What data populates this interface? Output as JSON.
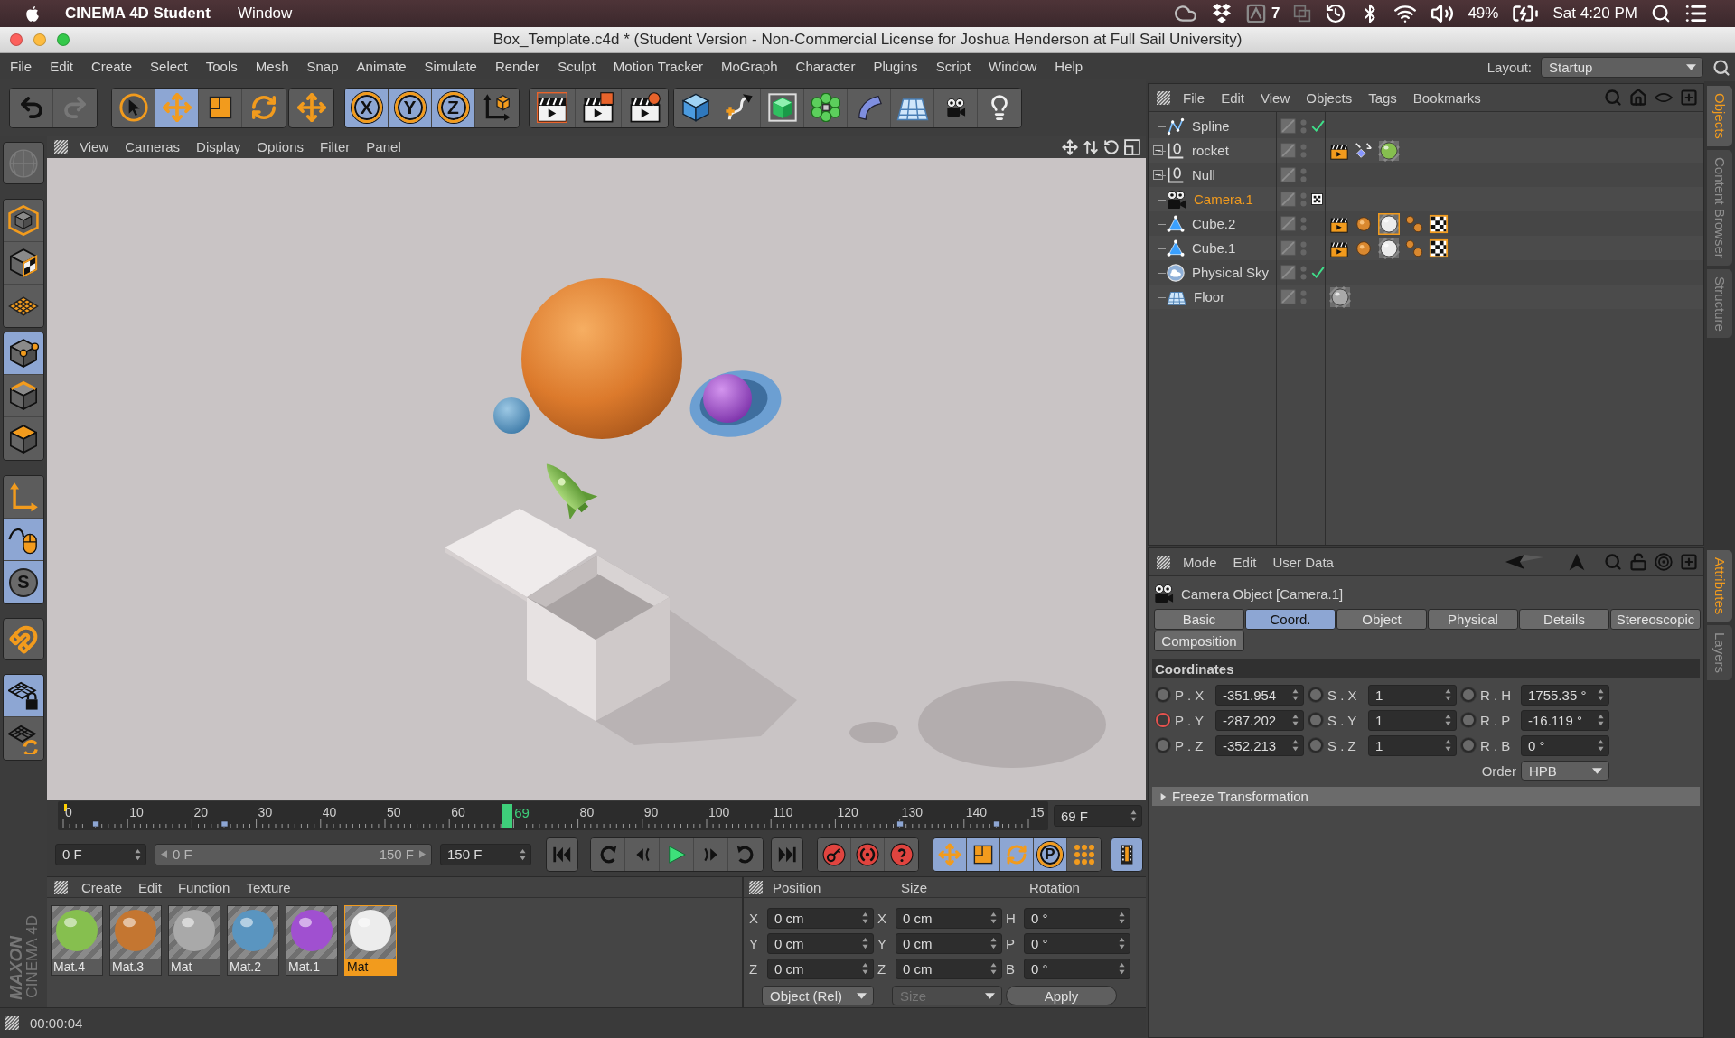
{
  "system_bar": {
    "app_name": "CINEMA 4D Student",
    "menus": [
      "Window"
    ],
    "badge": "7",
    "battery": "49%",
    "clock": "Sat 4:20 PM"
  },
  "window": {
    "title": "Box_Template.c4d * (Student Version - Non-Commercial License for Joshua Henderson at Full Sail University)"
  },
  "menu": [
    "File",
    "Edit",
    "Create",
    "Select",
    "Tools",
    "Mesh",
    "Snap",
    "Animate",
    "Simulate",
    "Render",
    "Sculpt",
    "Motion Tracker",
    "MoGraph",
    "Character",
    "Plugins",
    "Script",
    "Window",
    "Help"
  ],
  "layout": {
    "label": "Layout:",
    "value": "Startup"
  },
  "toolbar": {
    "history": [
      {
        "disabled": false
      },
      {
        "disabled": true
      }
    ],
    "tools": [
      {
        "selected": false
      },
      {
        "selected": true
      },
      {
        "selected": false
      },
      {
        "selected": false
      }
    ],
    "recent": {
      "selected": false
    },
    "axes": [
      {
        "label": "X",
        "on": true
      },
      {
        "label": "Y",
        "on": true
      },
      {
        "label": "Z",
        "on": true
      }
    ]
  },
  "mode_bar": [
    {
      "on": false,
      "disabled": true
    },
    {
      "on": false,
      "disabled": false
    },
    {
      "on": false,
      "disabled": false
    },
    {
      "on": false,
      "disabled": false
    },
    {
      "on": true,
      "disabled": false
    },
    {
      "on": false,
      "disabled": false
    },
    {
      "on": false,
      "disabled": false
    },
    {
      "on": false,
      "disabled": false
    },
    {
      "on": true,
      "disabled": false
    },
    {
      "on": true,
      "disabled": false,
      "label": "S"
    },
    {
      "on": false,
      "disabled": false
    },
    {
      "on": true,
      "disabled": false
    },
    {
      "on": false,
      "disabled": false
    }
  ],
  "brand": {
    "company": "MAXON",
    "product": "CINEMA 4D"
  },
  "viewport": {
    "menus": [
      "View",
      "Cameras",
      "Display",
      "Options",
      "Filter",
      "Panel"
    ]
  },
  "timeline": {
    "ticks": [
      "0",
      "10",
      "20",
      "30",
      "40",
      "50",
      "60"
    ],
    "ticks_after_playhead": [
      "80",
      "90",
      "100",
      "110",
      "120",
      "130",
      "140",
      "15"
    ],
    "playhead": {
      "label": "69",
      "level": 0.46
    },
    "frame_field": "69 F"
  },
  "range": {
    "start": "0 F",
    "slider_start": "0 F",
    "slider_end": "150 F",
    "end": "150 F"
  },
  "key_toggles": [
    {
      "on": true
    },
    {
      "on": true
    },
    {
      "on": true
    },
    {
      "on": true,
      "label": "P"
    },
    {
      "on": false
    }
  ],
  "timeline_button": {
    "on": true
  },
  "materials": {
    "menus": [
      "Create",
      "Edit",
      "Function",
      "Texture"
    ],
    "items": [
      {
        "name": "Mat.4",
        "color": "#86bf4f",
        "selected": false
      },
      {
        "name": "Mat.3",
        "color": "#c47631",
        "selected": false
      },
      {
        "name": "Mat",
        "color": "#a9a9a9",
        "selected": false
      },
      {
        "name": "Mat.2",
        "color": "#5a95c0",
        "selected": false
      },
      {
        "name": "Mat.1",
        "color": "#a050d0",
        "selected": false
      },
      {
        "name": "Mat",
        "color": "#ececec",
        "selected": true
      }
    ]
  },
  "coordinates": {
    "headers": [
      "Position",
      "Size",
      "Rotation"
    ],
    "rows": [
      {
        "position_axis": "X",
        "position": "0 cm",
        "size_axis": "X",
        "size": "0 cm",
        "rotation_axis": "H",
        "rotation": "0 °"
      },
      {
        "position_axis": "Y",
        "position": "0 cm",
        "size_axis": "Y",
        "size": "0 cm",
        "rotation_axis": "P",
        "rotation": "0 °"
      },
      {
        "position_axis": "Z",
        "position": "0 cm",
        "size_axis": "Z",
        "size": "0 cm",
        "rotation_axis": "B",
        "rotation": "0 °"
      }
    ],
    "mode": "Object (Rel)",
    "size_mode": {
      "label": "Size",
      "disabled": true
    },
    "apply": "Apply"
  },
  "status_bar": {
    "time": "00:00:04"
  },
  "objects": {
    "menus": [
      "File",
      "Edit",
      "View",
      "Objects",
      "Tags",
      "Bookmarks"
    ],
    "items": [
      {
        "name": "Spline",
        "kind": "spline",
        "selected": false,
        "collapsed": false,
        "enabled": true,
        "active_view": false
      },
      {
        "name": "rocket",
        "kind": "null",
        "selected": false,
        "collapsed": true,
        "enabled": false,
        "active_view": false,
        "tags": [
          {
            "kind": "render",
            "selected": false
          },
          {
            "kind": "align",
            "selected": false
          },
          {
            "kind": "material",
            "color": "#86bf4f",
            "selected": false
          }
        ]
      },
      {
        "name": "Null",
        "kind": "null",
        "selected": false,
        "collapsed": true,
        "enabled": false,
        "active_view": false
      },
      {
        "name": "Camera.1",
        "kind": "camera",
        "selected": true,
        "collapsed": false,
        "enabled": false,
        "active_view": true
      },
      {
        "name": "Cube.2",
        "kind": "primitive",
        "selected": false,
        "collapsed": false,
        "enabled": false,
        "active_view": false,
        "tags": [
          {
            "kind": "render",
            "selected": false
          },
          {
            "kind": "sphere",
            "selected": false
          },
          {
            "kind": "material",
            "color": "#ececec",
            "selected": true
          },
          {
            "kind": "dots",
            "selected": false
          },
          {
            "kind": "checker",
            "selected": false
          }
        ]
      },
      {
        "name": "Cube.1",
        "kind": "primitive",
        "selected": false,
        "collapsed": false,
        "enabled": false,
        "active_view": false,
        "tags": [
          {
            "kind": "render",
            "selected": false
          },
          {
            "kind": "sphere",
            "selected": false
          },
          {
            "kind": "material",
            "color": "#ececec",
            "selected": false
          },
          {
            "kind": "dots",
            "selected": false
          },
          {
            "kind": "checker",
            "selected": false
          }
        ]
      },
      {
        "name": "Physical Sky",
        "kind": "sky",
        "selected": false,
        "collapsed": false,
        "enabled": true,
        "active_view": false
      },
      {
        "name": "Floor",
        "kind": "floor",
        "selected": false,
        "collapsed": false,
        "enabled": false,
        "active_view": false,
        "tags": [
          {
            "kind": "material",
            "color": "#a9a9a9",
            "selected": false
          }
        ]
      }
    ]
  },
  "attributes": {
    "menus": [
      "Mode",
      "Edit",
      "User Data"
    ],
    "title": "Camera Object [Camera.1]",
    "tabs": [
      {
        "label": "Basic",
        "selected": false
      },
      {
        "label": "Coord.",
        "selected": true
      },
      {
        "label": "Object",
        "selected": false
      },
      {
        "label": "Physical",
        "selected": false
      },
      {
        "label": "Details",
        "selected": false
      },
      {
        "label": "Stereoscopic",
        "selected": false
      },
      {
        "label": "Composition",
        "selected": false
      }
    ],
    "section": "Coordinates",
    "rows": [
      {
        "fields": [
          {
            "label": "P . X",
            "value": "-351.954",
            "keyed": false
          },
          {
            "label": "S . X",
            "value": "1",
            "keyed": false
          },
          {
            "label": "R . H",
            "value": "1755.35 °",
            "keyed": false
          }
        ]
      },
      {
        "fields": [
          {
            "label": "P . Y",
            "value": "-287.202",
            "keyed": true
          },
          {
            "label": "S . Y",
            "value": "1",
            "keyed": false
          },
          {
            "label": "R . P",
            "value": "-16.119 °",
            "keyed": false
          }
        ]
      },
      {
        "fields": [
          {
            "label": "P . Z",
            "value": "-352.213",
            "keyed": false
          },
          {
            "label": "S . Z",
            "value": "1",
            "keyed": false
          },
          {
            "label": "R . B",
            "value": "0 °",
            "keyed": false
          }
        ]
      }
    ],
    "order": {
      "label": "Order",
      "value": "HPB"
    },
    "group": {
      "label": "Freeze Transformation",
      "expanded": false
    }
  },
  "dock_tabs": {
    "upper": [
      {
        "label": "Objects",
        "selected": true
      },
      {
        "label": "Content Browser",
        "selected": false
      },
      {
        "label": "Structure",
        "selected": false
      }
    ],
    "lower": [
      {
        "label": "Attributes",
        "selected": true
      },
      {
        "label": "Layers",
        "selected": false
      }
    ]
  }
}
